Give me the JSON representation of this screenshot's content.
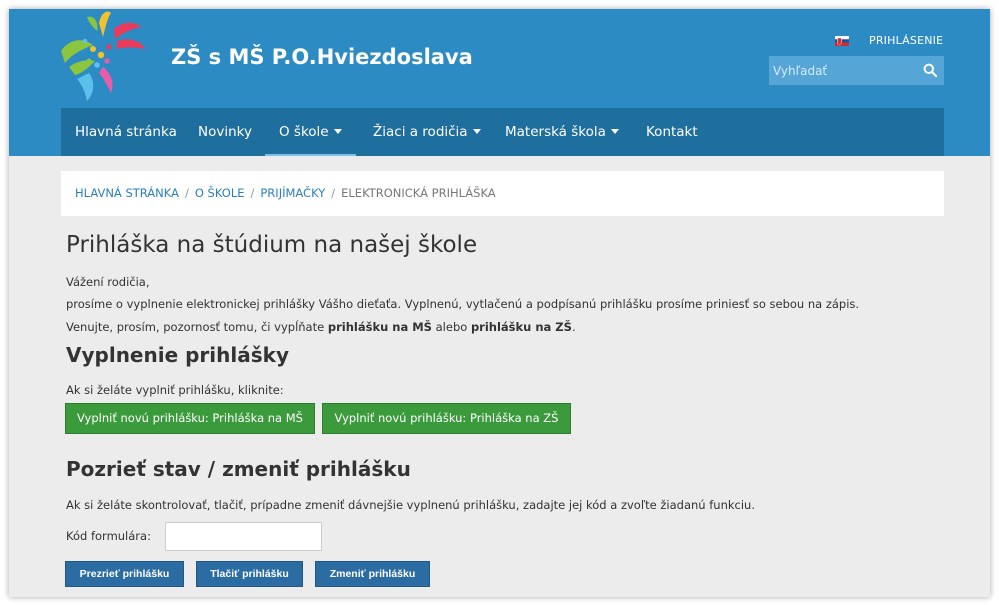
{
  "header": {
    "site_title": "ZŠ s MŠ P.O.Hviezdoslava",
    "login_label": "PRIHLÁSENIE",
    "search_placeholder": "Vyhľadať"
  },
  "nav": {
    "items": [
      {
        "label": "Hlavná stránka"
      },
      {
        "label": "Novinky"
      },
      {
        "label": "O škole"
      },
      {
        "label": "Žiaci a rodičia"
      },
      {
        "label": "Materská škola"
      },
      {
        "label": "Kontakt"
      }
    ]
  },
  "breadcrumb": {
    "items": [
      "HLAVNÁ STRÁNKA",
      "O ŠKOLE",
      "PRIJÍMAČKY"
    ],
    "current": "ELEKTRONICKÁ PRIHLÁŠKA"
  },
  "main": {
    "title": "Prihláška na štúdium na našej škole",
    "intro_line1": "Vážení rodičia,",
    "intro_line2": "prosíme o vyplnenie elektronickej prihlášky Vášho dieťaťa. Vyplnenú, vytlačenú a podpísanú prihlášku prosíme priniesť so sebou na zápis.",
    "intro_line3_pre": "Venujte, prosím, pozornosť tomu, či vypĺňate ",
    "intro_line3_b1": "prihlášku na MŠ",
    "intro_line3_mid": " alebo ",
    "intro_line3_b2": "prihlášku na ZŠ",
    "intro_line3_end": ".",
    "fill_heading": "Vyplnenie prihlášky",
    "fill_text": "Ak si želáte vyplniť prihlášku, kliknite:",
    "btn_ms": "Vyplniť novú prihlášku: Prihláška na MŠ",
    "btn_zs": "Vyplniť novú prihlášku: Prihláška na ZŠ",
    "status_heading": "Pozrieť stav / zmeniť prihlášku",
    "status_text": "Ak si želáte skontrolovať, tlačiť, prípadne zmeniť dávnejšie vyplnenú prihlášku, zadajte jej kód a zvoľte žiadanú funkciu.",
    "code_label": "Kód formulára:",
    "code_value": "",
    "btn_view": "Prezrieť prihlášku",
    "btn_print": "Tlačiť prihlášku",
    "btn_change": "Zmeniť prihlášku"
  },
  "colors": {
    "header_bg": "#2d8bc4",
    "nav_bg": "#1f6f9e",
    "green_button": "#3b9a3b",
    "blue_button": "#2b6ca3",
    "link": "#2a7fb8"
  }
}
